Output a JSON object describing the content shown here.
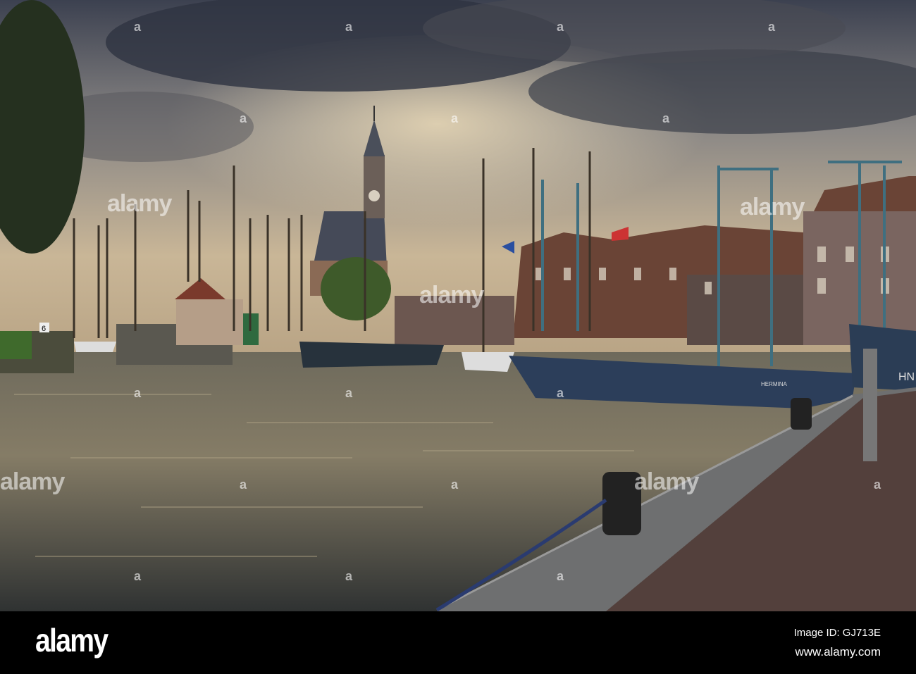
{
  "photo": {
    "description_alt": "Harbour with sailing ships and clock tower",
    "boat_name": "HERMINA",
    "boat_reg": "HN",
    "sign_number": "6"
  },
  "watermark": {
    "text": "alamy",
    "letter": "a"
  },
  "footer": {
    "logo": "alamy",
    "image_id": "Image ID: GJ713E",
    "website": "www.alamy.com"
  }
}
